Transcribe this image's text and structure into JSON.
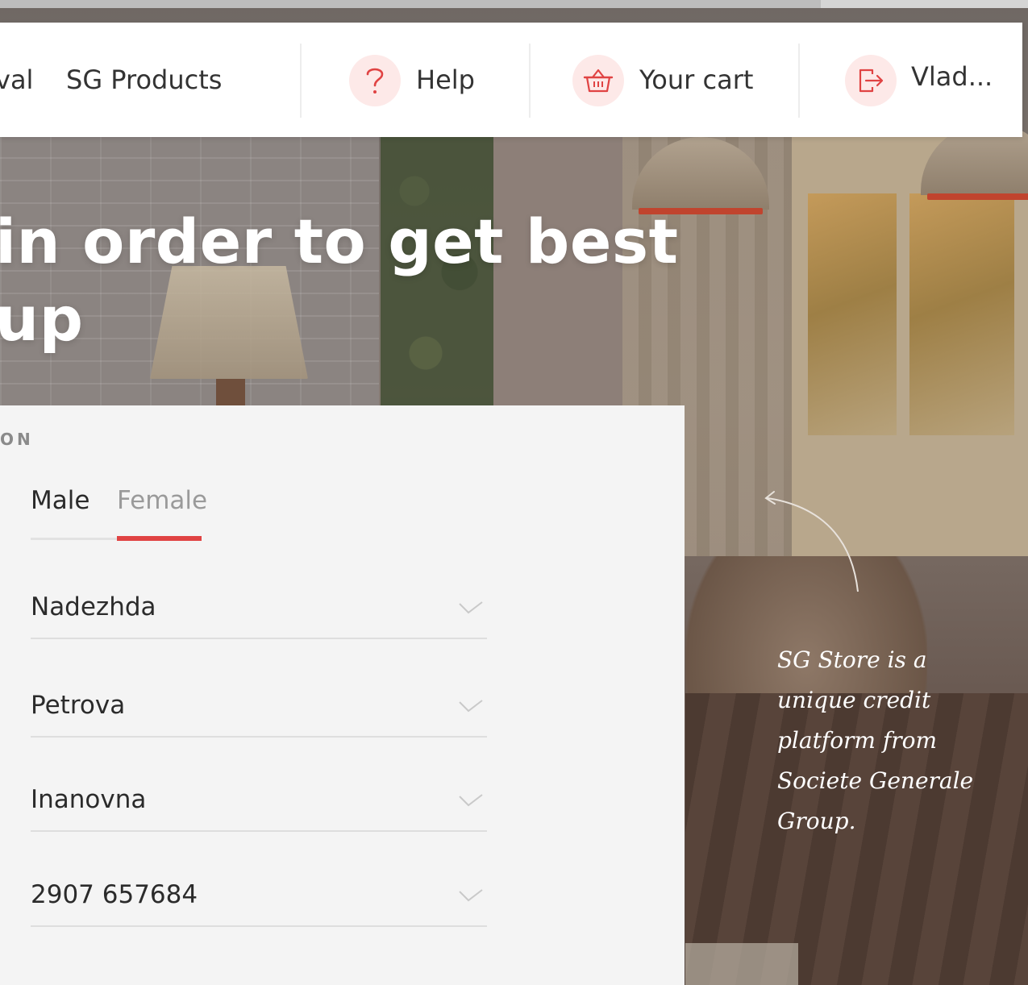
{
  "nav": {
    "partial_link": "val",
    "sg_products": "SG Products",
    "help": "Help",
    "cart": "Your cart",
    "user": "Vlad..."
  },
  "hero": {
    "line1": "in order to get best",
    "line2": "up"
  },
  "form": {
    "section_label": "ON",
    "gender": {
      "options": [
        "Male",
        "Female"
      ],
      "selected": "Female"
    },
    "fields": [
      {
        "value": "Nadezhda"
      },
      {
        "value": "Petrova"
      },
      {
        "value": "Inanovna"
      },
      {
        "value": "2907 657684"
      }
    ]
  },
  "caption": "SG Store is a unique credit platform from Societe Generale Group.",
  "colors": {
    "accent": "#e04343",
    "icon_bg": "#fde9e8",
    "card_bg": "#f4f4f4"
  },
  "icons": {
    "help": "question-mark-icon",
    "cart": "basket-icon",
    "user": "logout-icon",
    "field_check": "check-icon"
  }
}
